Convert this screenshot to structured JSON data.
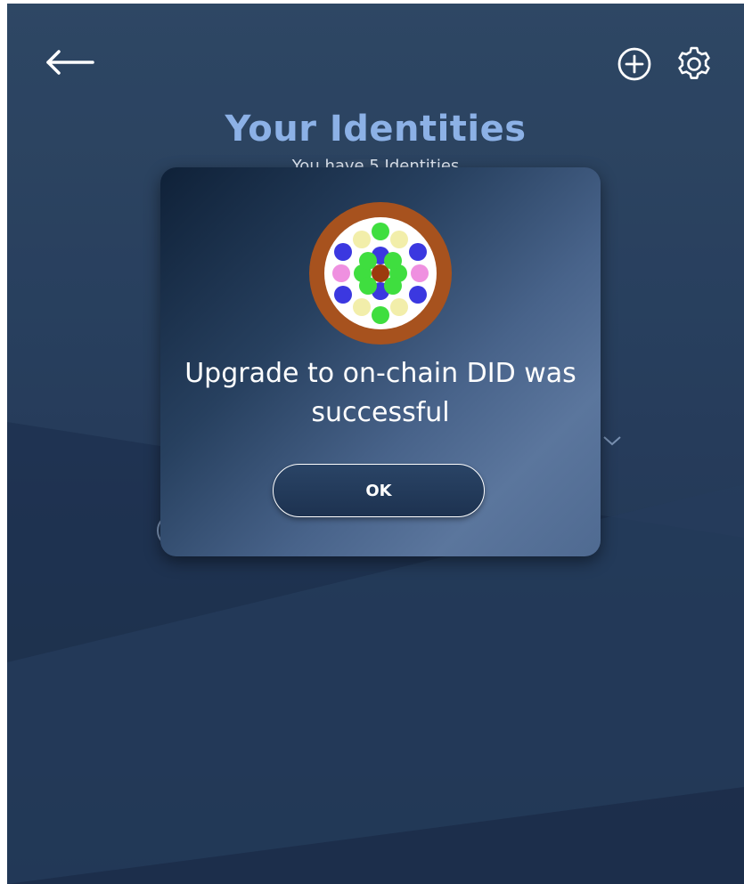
{
  "header": {
    "title": "Your Identities",
    "subtitle": "You have 5 Identities",
    "back_icon": "arrow-left-icon",
    "add_icon": "plus-circle-icon",
    "settings_icon": "gear-icon"
  },
  "dialog": {
    "avatar_icon": "identicon-avatar",
    "message": "Upgrade to on-chain DID was successful",
    "ok_label": "OK"
  },
  "colors": {
    "background": "#2b4263",
    "title": "#8cb1e6",
    "text": "#ffffff",
    "avatar_ring": "#a7521e",
    "avatar_center": "#9c3a0e",
    "dot_blue": "#3b38e0",
    "dot_green": "#3fde3f",
    "dot_yellow": "#f2eeaa",
    "dot_pink": "#ef90e0"
  }
}
